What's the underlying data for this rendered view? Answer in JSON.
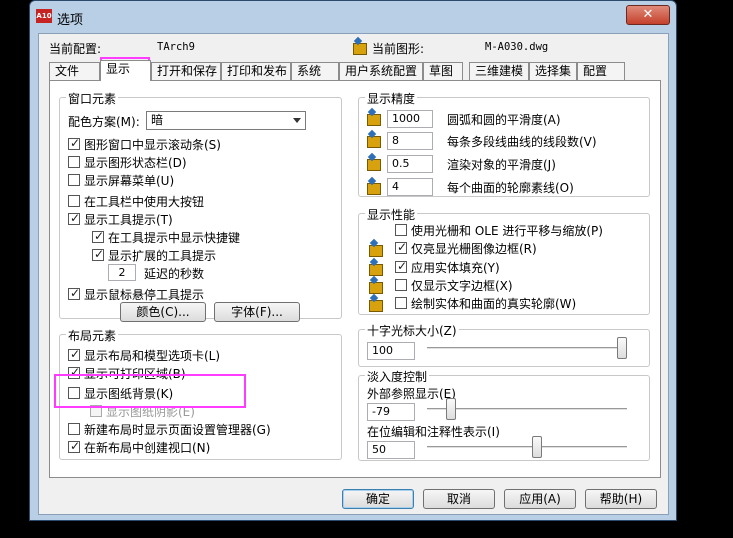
{
  "window": {
    "title": "选项",
    "app_icon_text": "A10",
    "close_glyph": "✕"
  },
  "header": {
    "profile_label": "当前配置:",
    "profile_value": "TArch9",
    "drawing_label": "当前图形:",
    "drawing_value": "M-A030.dwg"
  },
  "tabs": [
    "文件",
    "显示",
    "打开和保存",
    "打印和发布",
    "系统",
    "用户系统配置",
    "草图",
    "三维建模",
    "选择集",
    "配置"
  ],
  "active_tab": "显示",
  "window_elements": {
    "title": "窗口元素",
    "color_scheme_label": "配色方案(M):",
    "color_scheme_value": "暗",
    "scrollbars": "图形窗口中显示滚动条(S)",
    "status_bar": "显示图形状态栏(D)",
    "screen_menu": "显示屏幕菜单(U)",
    "large_buttons": "在工具栏中使用大按钮",
    "tooltips": "显示工具提示(T)",
    "tooltip_shortcuts": "在工具提示中显示快捷键",
    "extended_tooltips": "显示扩展的工具提示",
    "delay_value": "2",
    "delay_label": "延迟的秒数",
    "rollover_tooltips": "显示鼠标悬停工具提示",
    "colors_button": "颜色(C)...",
    "fonts_button": "字体(F)..."
  },
  "layout_elements": {
    "title": "布局元素",
    "layout_tabs": "显示布局和模型选项卡(L)",
    "printable_area": "显示可打印区域(B)",
    "paper_background": "显示图纸背景(K)",
    "paper_shadow": "显示图纸阴影(E)",
    "page_setup_manager": "新建布局时显示页面设置管理器(G)",
    "create_viewport": "在新布局中创建视口(N)"
  },
  "display_resolution": {
    "title": "显示精度",
    "arc_smoothness_value": "1000",
    "arc_smoothness_label": "圆弧和圆的平滑度(A)",
    "polyline_segments_value": "8",
    "polyline_segments_label": "每条多段线曲线的线段数(V)",
    "render_smoothness_value": "0.5",
    "render_smoothness_label": "渲染对象的平滑度(J)",
    "contour_lines_value": "4",
    "contour_lines_label": "每个曲面的轮廓素线(O)"
  },
  "display_performance": {
    "title": "显示性能",
    "pan_zoom_raster": "使用光栅和 OLE 进行平移与缩放(P)",
    "highlight_raster": "仅亮显光栅图像边框(R)",
    "true_color_fill": "应用实体填充(Y)",
    "text_frame": "仅显示文字边框(X)",
    "silhouettes": "绘制实体和曲面的真实轮廓(W)"
  },
  "crosshair": {
    "title": "十字光标大小(Z)",
    "value": "100",
    "fraction": 1.0
  },
  "fade_control": {
    "title": "淡入度控制",
    "xref_label": "外部参照显示(E)",
    "xref_value": "-79",
    "xref_fraction": 0.1,
    "inplace_label": "在位编辑和注释性表示(I)",
    "inplace_value": "50",
    "inplace_fraction": 0.55
  },
  "buttons": {
    "ok": "确定",
    "cancel": "取消",
    "apply": "应用(A)",
    "help": "帮助(H)"
  },
  "colors": {
    "highlight": "#ff3cff",
    "frame": "#b9cfe6",
    "close": "#c4412c"
  }
}
